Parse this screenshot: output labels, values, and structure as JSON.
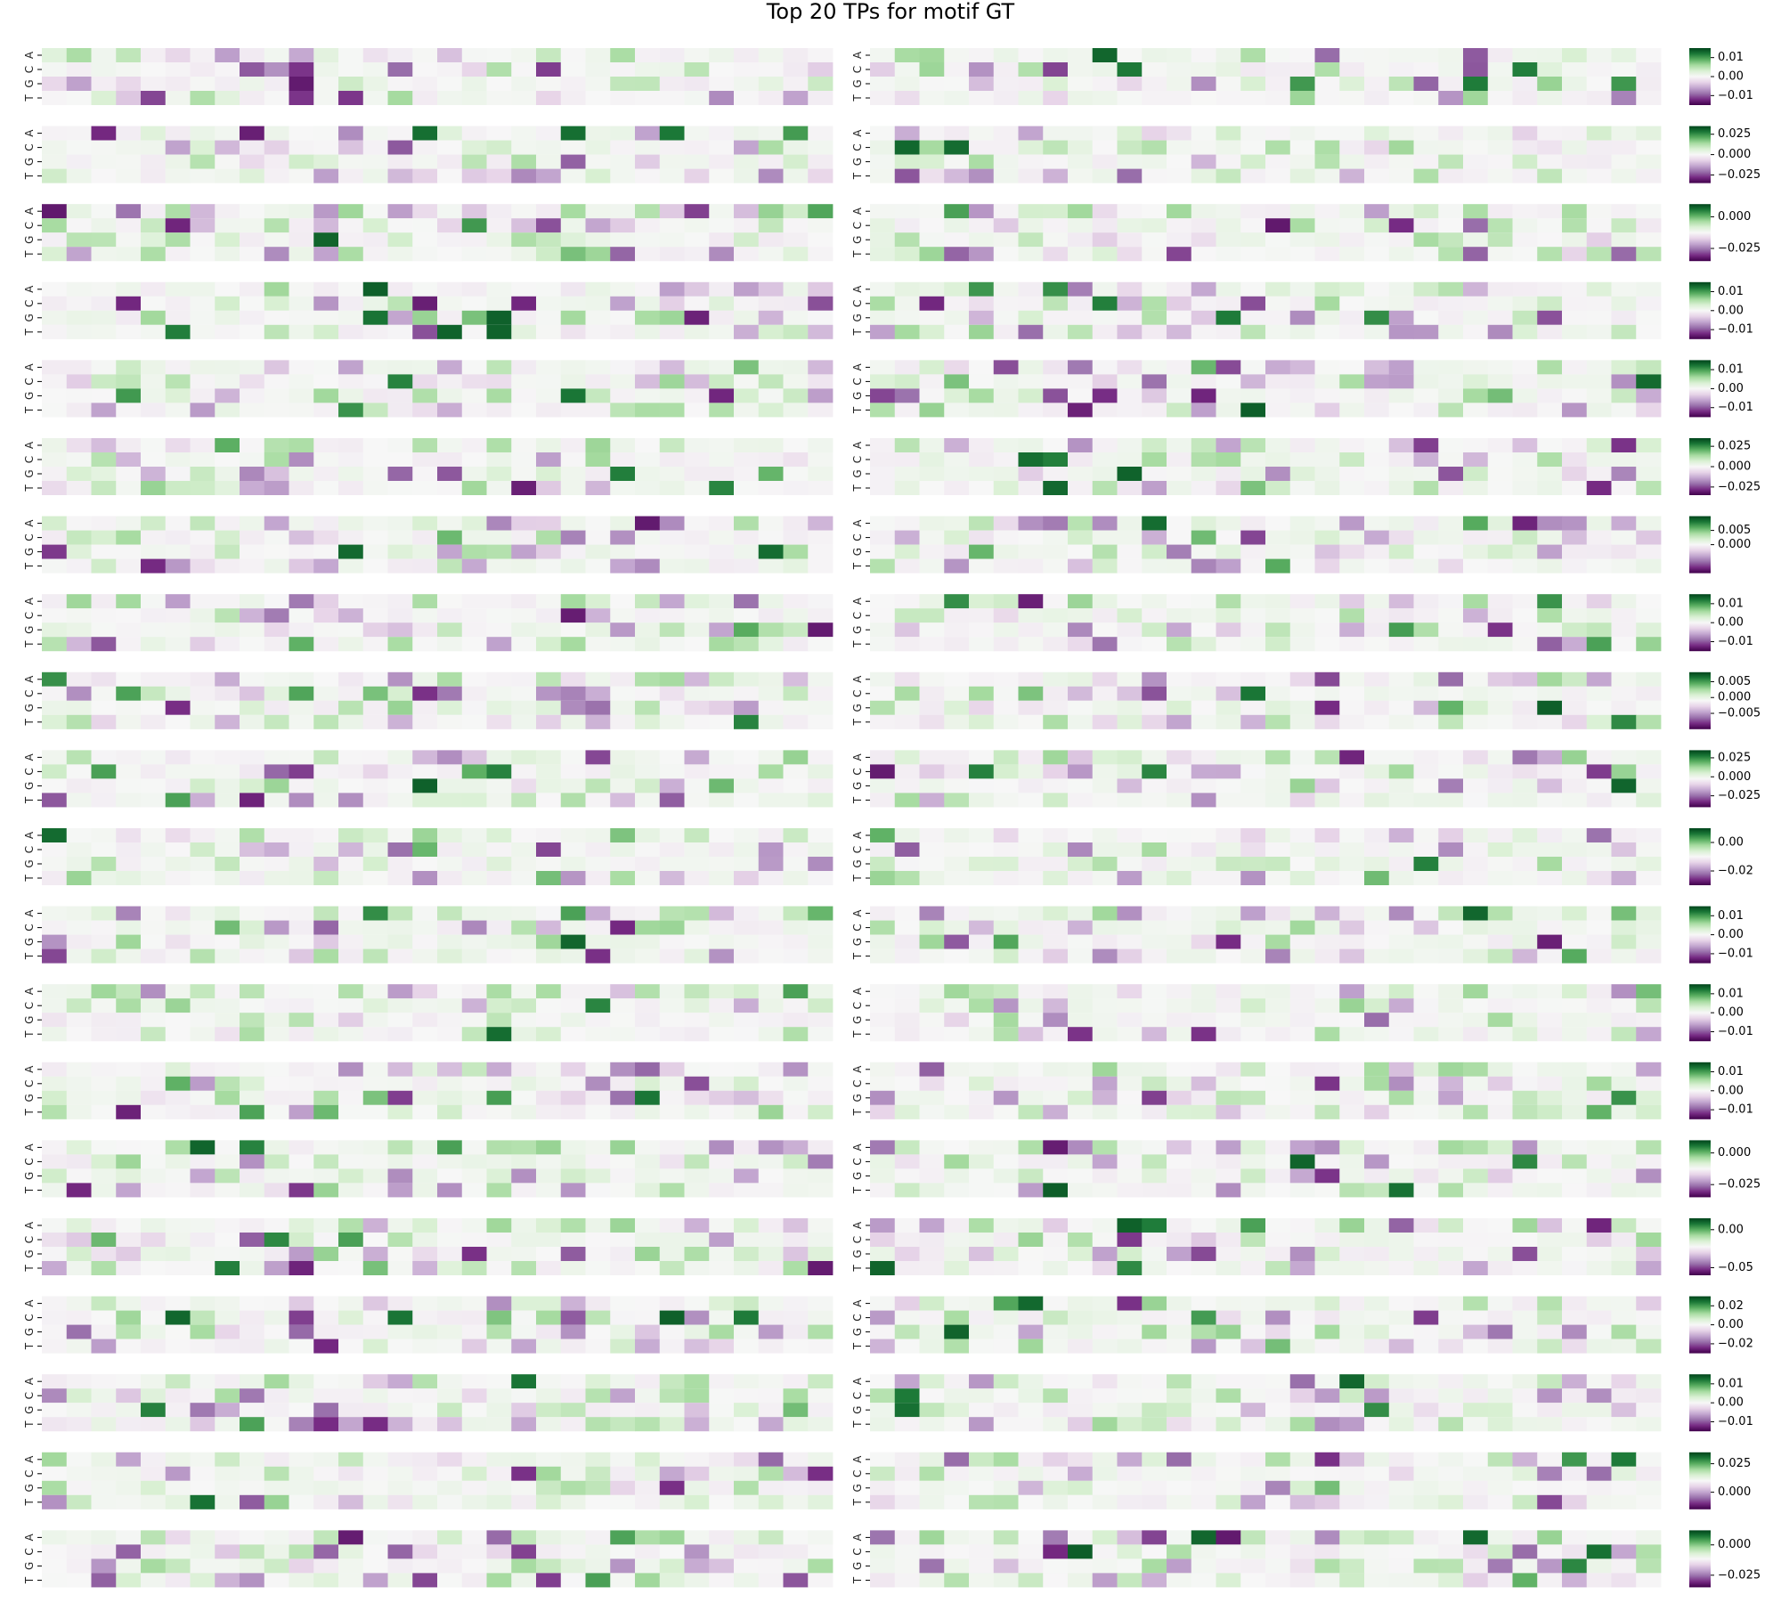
{
  "title": "Top 20 TPs for motif GT",
  "chart_data": {
    "type": "heatmap",
    "title": "Top 20 TPs for motif GT",
    "rows": [
      "A",
      "C",
      "G",
      "T"
    ],
    "positions_per_strip": 32,
    "colormap": "PRGn",
    "colormap_stops": [
      "#40004b",
      "#762a83",
      "#9970ab",
      "#c2a5cf",
      "#e7d4e8",
      "#f7f7f7",
      "#d9f0d3",
      "#a6dba0",
      "#5aae61",
      "#1b7837",
      "#00441b"
    ],
    "panels": [
      {
        "vmin": -0.015,
        "vmax": 0.015,
        "colorbar_ticks": [
          0.01,
          0.0,
          -0.01
        ],
        "colorbar_labels": [
          "0.01",
          "0.00",
          "−0.01"
        ]
      },
      {
        "vmin": -0.035,
        "vmax": 0.035,
        "colorbar_ticks": [
          0.025,
          0.0,
          -0.025
        ],
        "colorbar_labels": [
          "0.025",
          "0.000",
          "−0.025"
        ]
      },
      {
        "vmin": -0.035,
        "vmax": 0.01,
        "colorbar_ticks": [
          0.0,
          -0.025
        ],
        "colorbar_labels": [
          "0.000",
          "−0.025"
        ]
      },
      {
        "vmin": -0.015,
        "vmax": 0.015,
        "colorbar_ticks": [
          0.01,
          0.0,
          -0.01
        ],
        "colorbar_labels": [
          "0.01",
          "0.00",
          "−0.01"
        ]
      },
      {
        "vmin": -0.015,
        "vmax": 0.015,
        "colorbar_ticks": [
          0.01,
          0.0,
          -0.01
        ],
        "colorbar_labels": [
          "0.01",
          "0.00",
          "−0.01"
        ]
      },
      {
        "vmin": -0.035,
        "vmax": 0.035,
        "colorbar_ticks": [
          0.025,
          0.0,
          -0.025
        ],
        "colorbar_labels": [
          "0.025",
          "0.000",
          "−0.025"
        ]
      },
      {
        "vmin": -0.01,
        "vmax": 0.01,
        "colorbar_ticks": [
          0.005,
          0.0
        ],
        "colorbar_labels": [
          "0.005",
          "0.000"
        ]
      },
      {
        "vmin": -0.015,
        "vmax": 0.015,
        "colorbar_ticks": [
          0.01,
          0.0,
          -0.01
        ],
        "colorbar_labels": [
          "0.01",
          "0.00",
          "−0.01"
        ]
      },
      {
        "vmin": -0.01,
        "vmax": 0.008,
        "colorbar_ticks": [
          0.005,
          0.0,
          -0.005
        ],
        "colorbar_labels": [
          "0.005",
          "0.000",
          "−0.005"
        ]
      },
      {
        "vmin": -0.04,
        "vmax": 0.035,
        "colorbar_ticks": [
          0.025,
          0.0,
          -0.025
        ],
        "colorbar_labels": [
          "0.025",
          "0.000",
          "−0.025"
        ]
      },
      {
        "vmin": -0.03,
        "vmax": 0.01,
        "colorbar_ticks": [
          0.0,
          -0.02
        ],
        "colorbar_labels": [
          "0.00",
          "−0.02"
        ]
      },
      {
        "vmin": -0.015,
        "vmax": 0.015,
        "colorbar_ticks": [
          0.01,
          0.0,
          -0.01
        ],
        "colorbar_labels": [
          "0.01",
          "0.00",
          "−0.01"
        ]
      },
      {
        "vmin": -0.015,
        "vmax": 0.015,
        "colorbar_ticks": [
          0.01,
          0.0,
          -0.01
        ],
        "colorbar_labels": [
          "0.01",
          "0.00",
          "−0.01"
        ]
      },
      {
        "vmin": -0.015,
        "vmax": 0.015,
        "colorbar_ticks": [
          0.01,
          0.0,
          -0.01
        ],
        "colorbar_labels": [
          "0.01",
          "0.00",
          "−0.01"
        ]
      },
      {
        "vmin": -0.035,
        "vmax": 0.01,
        "colorbar_ticks": [
          0.0,
          -0.025
        ],
        "colorbar_labels": [
          "0.000",
          "−0.025"
        ]
      },
      {
        "vmin": -0.06,
        "vmax": 0.015,
        "colorbar_ticks": [
          0.0,
          -0.05
        ],
        "colorbar_labels": [
          "0.00",
          "−0.05"
        ]
      },
      {
        "vmin": -0.03,
        "vmax": 0.03,
        "colorbar_ticks": [
          0.02,
          0.0,
          -0.02
        ],
        "colorbar_labels": [
          "0.02",
          "0.00",
          "−0.02"
        ]
      },
      {
        "vmin": -0.015,
        "vmax": 0.015,
        "colorbar_ticks": [
          0.01,
          0.0,
          -0.01
        ],
        "colorbar_labels": [
          "0.01",
          "0.00",
          "−0.01"
        ]
      },
      {
        "vmin": -0.015,
        "vmax": 0.035,
        "colorbar_ticks": [
          0.025,
          0.0
        ],
        "colorbar_labels": [
          "0.025",
          "0.000"
        ]
      },
      {
        "vmin": -0.035,
        "vmax": 0.012,
        "colorbar_ticks": [
          0.0,
          -0.025
        ],
        "colorbar_labels": [
          "0.000",
          "−0.025"
        ]
      }
    ]
  }
}
